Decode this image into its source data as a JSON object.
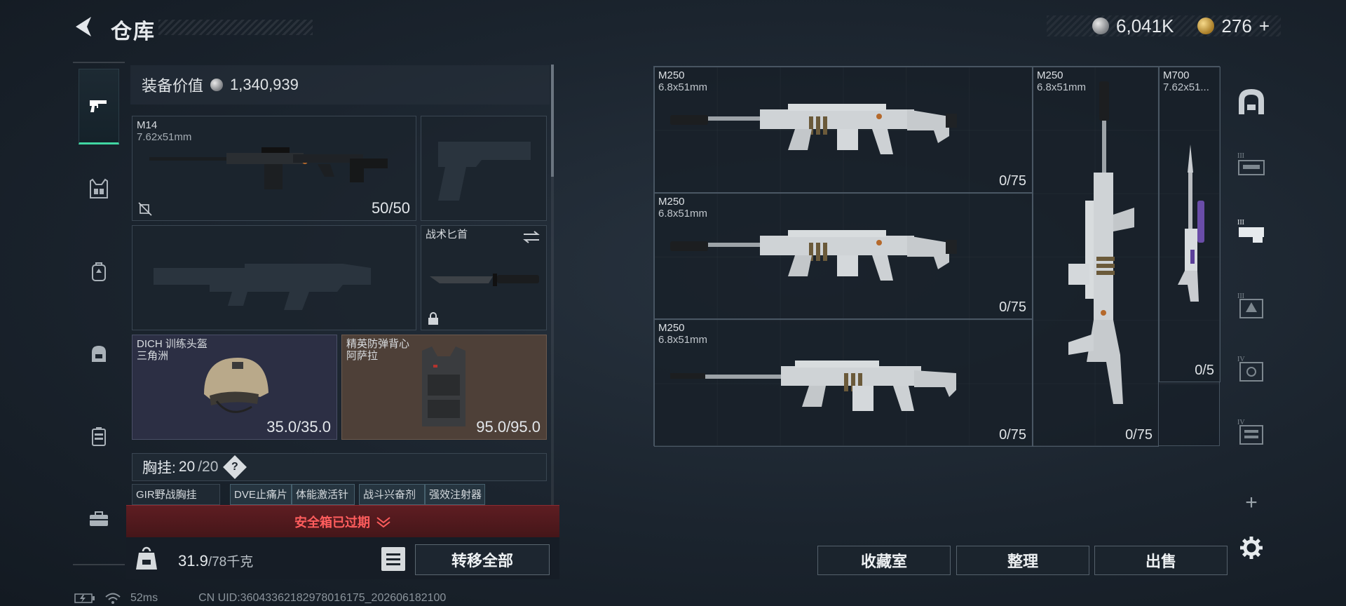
{
  "header": {
    "title": "仓库",
    "silver_amount": "6,041K",
    "gold_amount": "276",
    "gold_add": "+"
  },
  "left_rail": {
    "items": [
      "pistol-icon",
      "vest-icon",
      "backpack-icon",
      "bag-icon",
      "case-icon",
      "toolbox-icon"
    ]
  },
  "equipment": {
    "value_label": "装备价值",
    "value": "1,340,939",
    "primary": {
      "name": "M14",
      "caliber": "7.62x51mm",
      "ammo": "50/50"
    },
    "knife": {
      "name": "战术匕首"
    },
    "helmet": {
      "name": "DICH 训练头盔",
      "origin": "三角洲",
      "durability": "35.0/35.0"
    },
    "armor": {
      "name": "精英防弹背心",
      "origin": "阿萨拉",
      "durability": "95.0/95.0"
    },
    "vest_label": "胸挂:",
    "vest_current": "20",
    "vest_max": "/20",
    "help": "?",
    "vest_items": [
      "GIR野战胸挂",
      "DVE止痛片",
      "体能激活针",
      "战斗兴奋剂",
      "强效注射器"
    ]
  },
  "safe_box": {
    "expired_text": "安全箱已过期"
  },
  "inventory": {
    "weight_current": "31.9",
    "weight_max": "/78千克",
    "transfer_all": "转移全部"
  },
  "status": {
    "ping": "52ms",
    "uid": "CN UID:3604336218297801617​5_202606182100"
  },
  "stash": {
    "items": [
      {
        "name": "M250",
        "caliber": "6.8x51mm",
        "count": "0/75"
      },
      {
        "name": "M250",
        "caliber": "6.8x51mm",
        "count": "0/75"
      },
      {
        "name": "M250",
        "caliber": "6.8x51mm",
        "count": "0/75"
      },
      {
        "name": "M250",
        "caliber": "6.8x51mm",
        "count": "0/75"
      },
      {
        "name": "M700",
        "caliber": "7.62x51...",
        "count": "0/5"
      }
    ]
  },
  "right_rail": {
    "items": [
      "stash-tab-icon",
      "tier-3-case-icon",
      "tier-3-case-2-icon",
      "tier-3-bag-icon",
      "tier-4-case-icon",
      "tier-4-box-icon"
    ],
    "tiers": [
      "III",
      "III",
      "III",
      "IV",
      "IV"
    ],
    "add": "+"
  },
  "actions": {
    "collection": "收藏室",
    "organize": "整理",
    "sell": "出售"
  },
  "colors": {
    "accent": "#41d6a2",
    "warning": "#ff5d5d",
    "armor_bg": "#4e4038",
    "helmet_bg": "#2c2f44"
  }
}
